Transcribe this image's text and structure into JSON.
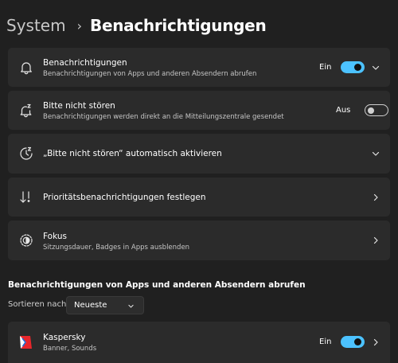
{
  "breadcrumb": {
    "parent": "System",
    "separator": "›",
    "current": "Benachrichtigungen"
  },
  "settings": [
    {
      "title": "Benachrichtigungen",
      "subtitle": "Benachrichtigungen von Apps und anderen Absendern abrufen",
      "state": "Ein",
      "toggle_on": true,
      "icon": "bell-icon",
      "chevron": "chevron-down-icon"
    },
    {
      "title": "Bitte nicht stören",
      "subtitle": "Benachrichtigungen werden direkt an die Mitteilungszentrale gesendet",
      "state": "Aus",
      "toggle_on": false,
      "icon": "bell-snooze-icon"
    },
    {
      "title": "„Bitte nicht stören“ automatisch aktivieren",
      "icon": "clock-icon",
      "chevron": "chevron-down-icon"
    },
    {
      "title": "Prioritätsbenachrichtigungen festlegen",
      "icon": "priority-sort-icon",
      "chevron": "chevron-right-icon"
    },
    {
      "title": "Fokus",
      "subtitle": "Sitzungsdauer, Badges in Apps ausblenden",
      "icon": "focus-icon",
      "chevron": "chevron-right-icon"
    }
  ],
  "apps_section": {
    "heading": "Benachrichtigungen von Apps und anderen Absendern abrufen",
    "sort_label": "Sortieren nach:",
    "sort_value": "Neueste"
  },
  "apps": [
    {
      "name": "Kaspersky",
      "subtitle": "Banner, Sounds",
      "state": "Ein",
      "toggle_on": true,
      "icon": "kaspersky-logo-icon"
    }
  ],
  "colors": {
    "background": "#202020",
    "card": "#2b2b2b",
    "accent": "#4cc2ff",
    "kaspersky_red": "#e8262b"
  }
}
